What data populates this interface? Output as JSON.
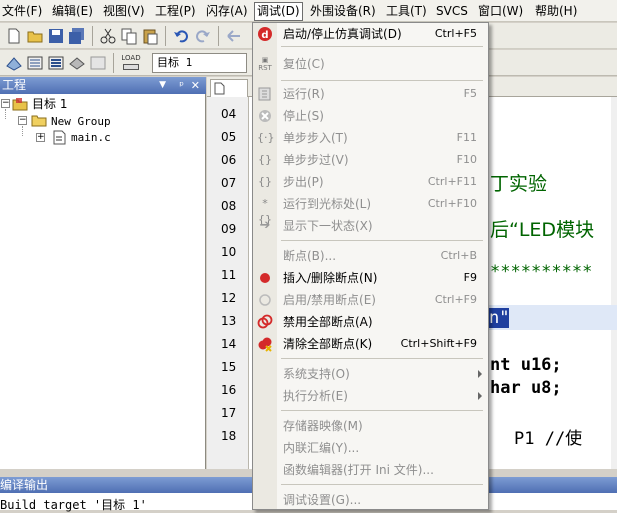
{
  "menubar": {
    "items": [
      {
        "label": "文件(F)"
      },
      {
        "label": "编辑(E)"
      },
      {
        "label": "视图(V)"
      },
      {
        "label": "工程(P)"
      },
      {
        "label": "闪存(A)"
      },
      {
        "label": "调试(D)"
      },
      {
        "label": "外围设备(R)"
      },
      {
        "label": "工具(T)"
      },
      {
        "label": "SVCS"
      },
      {
        "label": "窗口(W)"
      },
      {
        "label": "帮助(H)"
      }
    ]
  },
  "toolbar2": {
    "target": "目标 1",
    "load_label": "LOAD"
  },
  "project_panel": {
    "title": "工程",
    "tree": {
      "root": "目标 1",
      "group": "New Group",
      "file": "main.c"
    }
  },
  "editor": {
    "line_numbers": [
      "04",
      "05",
      "06",
      "07",
      "08",
      "09",
      "10",
      "11",
      "12",
      "13",
      "14",
      "15",
      "16",
      "17",
      "18"
    ],
    "code": {
      "l07": "丁实验",
      "l09": "后“LED模块",
      "l11": "**********",
      "l13": "n\"",
      "l15": "nt u16;",
      "l16": "har u8;",
      "l18": "P1  //使"
    }
  },
  "output_panel": {
    "title": "编译输出",
    "text": "Build target '目标 1'"
  },
  "debug_menu": {
    "items": [
      {
        "label": "启动/停止仿真调试(D)",
        "shortcut": "Ctrl+F5"
      },
      {
        "label": "复位(C)",
        "shortcut": ""
      },
      {
        "label": "运行(R)",
        "shortcut": "F5"
      },
      {
        "label": "停止(S)",
        "shortcut": ""
      },
      {
        "label": "单步步入(T)",
        "shortcut": "F11"
      },
      {
        "label": "单步步过(V)",
        "shortcut": "F10"
      },
      {
        "label": "步出(P)",
        "shortcut": "Ctrl+F11"
      },
      {
        "label": "运行到光标处(L)",
        "shortcut": "Ctrl+F10"
      },
      {
        "label": "显示下一状态(X)",
        "shortcut": ""
      },
      {
        "label": "断点(B)...",
        "shortcut": "Ctrl+B"
      },
      {
        "label": "插入/删除断点(N)",
        "shortcut": "F9"
      },
      {
        "label": "启用/禁用断点(E)",
        "shortcut": "Ctrl+F9"
      },
      {
        "label": "禁用全部断点(A)",
        "shortcut": ""
      },
      {
        "label": "清除全部断点(K)",
        "shortcut": "Ctrl+Shift+F9"
      },
      {
        "label": "系统支持(O)",
        "shortcut": ""
      },
      {
        "label": "执行分析(E)",
        "shortcut": ""
      },
      {
        "label": "存储器映像(M)",
        "shortcut": ""
      },
      {
        "label": "内联汇编(Y)...",
        "shortcut": ""
      },
      {
        "label": "函数编辑器(打开 Ini 文件)...",
        "shortcut": ""
      },
      {
        "label": "调试设置(G)...",
        "shortcut": ""
      }
    ],
    "icon_rst": "RST"
  },
  "colors": {
    "title_bar": "#4f6fb3",
    "breakpoint": "#d42a2a",
    "code_green": "#006400"
  }
}
